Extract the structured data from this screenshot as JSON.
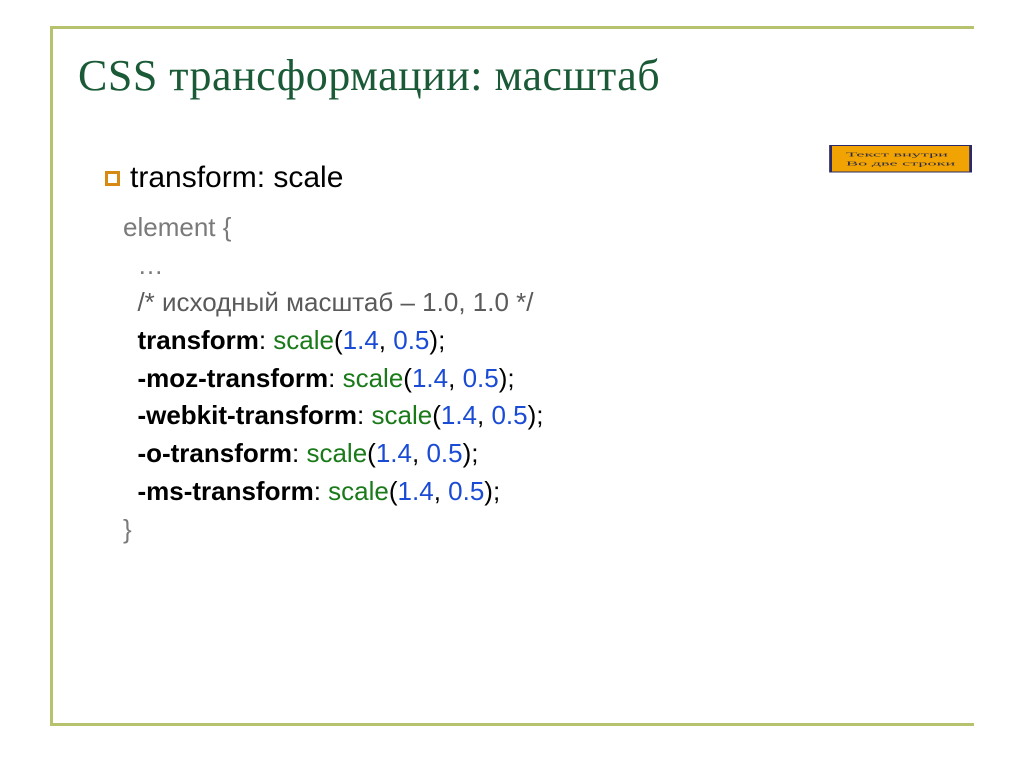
{
  "title": "CSS трансформации: масштаб",
  "bullet": "transform: scale",
  "sample": {
    "line1": "Текст внутри",
    "line2": "Во две строки"
  },
  "code": {
    "selector": "element {",
    "ellipsis": "…",
    "comment": "/* исходный масштаб – 1.0, 1.0 */",
    "props": [
      "transform",
      "-moz-transform",
      "-webkit-transform",
      "-o-transform",
      "-ms-transform"
    ],
    "func": "scale",
    "args": {
      "a": "1.4",
      "b": "0.5"
    },
    "close": "}"
  }
}
